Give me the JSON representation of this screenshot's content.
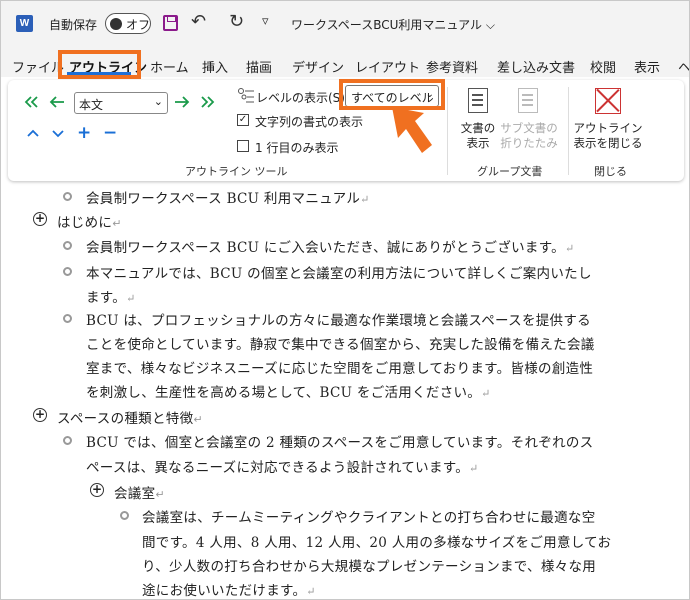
{
  "titlebar": {
    "app_logo": "W",
    "autosave_label": "自動保存",
    "autosave_state": "オフ",
    "title": "ワークスペースBCU利用マニュアル",
    "title_chevron": "⌵",
    "undo_icon": "↶",
    "redo_icon": "↻",
    "more_icon": "▿"
  },
  "tabs": [
    "ファイル",
    "アウトライン",
    "ホーム",
    "挿入",
    "描画",
    "デザイン",
    "レイアウト",
    "参考資料",
    "差し込み文書",
    "校閲",
    "表示",
    "ヘ"
  ],
  "active_tab": "アウトライン",
  "ribbon": {
    "outline_level_value": "本文",
    "show_level_label": "レベルの表示(S):",
    "show_level_value": "すべてのレベル",
    "show_text_formatting": "文字列の書式の表示",
    "show_text_formatting_checked": true,
    "show_first_line_only": "1 行目のみ表示",
    "show_first_line_only_checked": false,
    "group_outline_tools": "アウトライン ツール",
    "show_document_line1": "文書の",
    "show_document_line2": "表示",
    "collapse_sub_line1": "サブ文書の",
    "collapse_sub_line2": "折りたたみ",
    "group_master": "グループ文書",
    "close_outline_line1": "アウトライン",
    "close_outline_line2": "表示を閉じる",
    "group_close": "閉じる",
    "checkmark": "✓",
    "plus_icon": "+",
    "minus_icon": "−",
    "chev": "⌄"
  },
  "document": {
    "pm": "↵",
    "l1": "会員制ワークスペース BCU 利用マニュアル",
    "h1": "はじめに",
    "p1": "会員制ワークスペース BCU にご入会いただき、誠にありがとうございます。",
    "p2a": "本マニュアルでは、BCU の個室と会議室の利用方法について詳しくご案内いたし",
    "p2b": "ます。",
    "p3a": "BCU は、プロフェッショナルの方々に最適な作業環境と会議スペースを提供する",
    "p3b": "ことを使命としています。静寂で集中できる個室から、充実した設備を備えた会議",
    "p3c": "室まで、様々なビジネスニーズに応じた空間をご用意しております。皆様の創造性",
    "p3d": "を刺激し、生産性を高める場として、BCU をご活用ください。",
    "h2": "スペースの種類と特徴",
    "p4a": "BCU では、個室と会議室の 2 種類のスペースをご用意しています。それぞれのス",
    "p4b": "ペースは、異なるニーズに対応できるよう設計されています。",
    "h3": "会議室",
    "p5a": "会議室は、チームミーティングやクライアントとの打ち合わせに最適な空",
    "p5b": "間です。4 人用、8 人用、12 人用、20 人用の多様なサイズをご用意してお",
    "p5c": "り、少人数の打ち合わせから大規模なプレゼンテーションまで、様々な用",
    "p5d": "途にお使いいただけます。",
    "expand_icon": "+"
  }
}
